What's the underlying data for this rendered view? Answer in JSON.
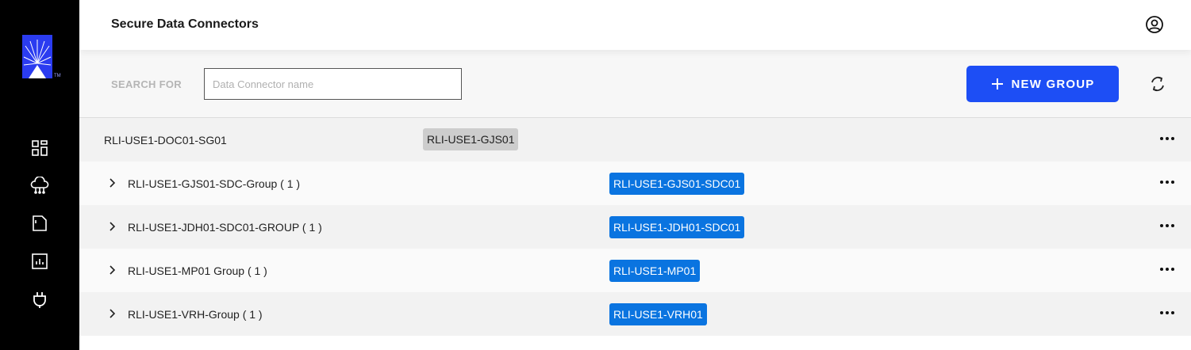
{
  "app": {
    "title": "Secure Data Connectors",
    "logo_tm": "TM"
  },
  "sidebar": {
    "items": [
      {
        "icon": "dashboard-icon"
      },
      {
        "icon": "cloud-network-icon"
      },
      {
        "icon": "document-icon"
      },
      {
        "icon": "report-chart-icon"
      },
      {
        "icon": "plug-icon"
      }
    ]
  },
  "toolbar": {
    "search_label": "SEARCH FOR",
    "search_placeholder": "Data Connector name",
    "search_value": "",
    "new_group_label": "NEW GROUP"
  },
  "rows": [
    {
      "name": "RLI-USE1-DOC01-SG01",
      "tag": "RLI-USE1-GJS01",
      "tag_style": "gray",
      "expandable": false
    },
    {
      "name": "RLI-USE1-GJS01-SDC-Group ( 1 )",
      "tag": "RLI-USE1-GJS01-SDC01",
      "tag_style": "blue",
      "expandable": true
    },
    {
      "name": "RLI-USE1-JDH01-SDC01-GROUP ( 1 )",
      "tag": "RLI-USE1-JDH01-SDC01",
      "tag_style": "blue",
      "expandable": true
    },
    {
      "name": "RLI-USE1-MP01 Group ( 1 )",
      "tag": "RLI-USE1-MP01",
      "tag_style": "blue",
      "expandable": true
    },
    {
      "name": "RLI-USE1-VRH-Group ( 1 )",
      "tag": "RLI-USE1-VRH01",
      "tag_style": "blue",
      "expandable": true
    }
  ],
  "colors": {
    "primary_button": "#1d4ef5",
    "tag_blue": "#0a74e0",
    "tag_gray": "#cdcdcd",
    "sidebar_bg": "#000000",
    "logo_blue": "#2b3cf0"
  }
}
